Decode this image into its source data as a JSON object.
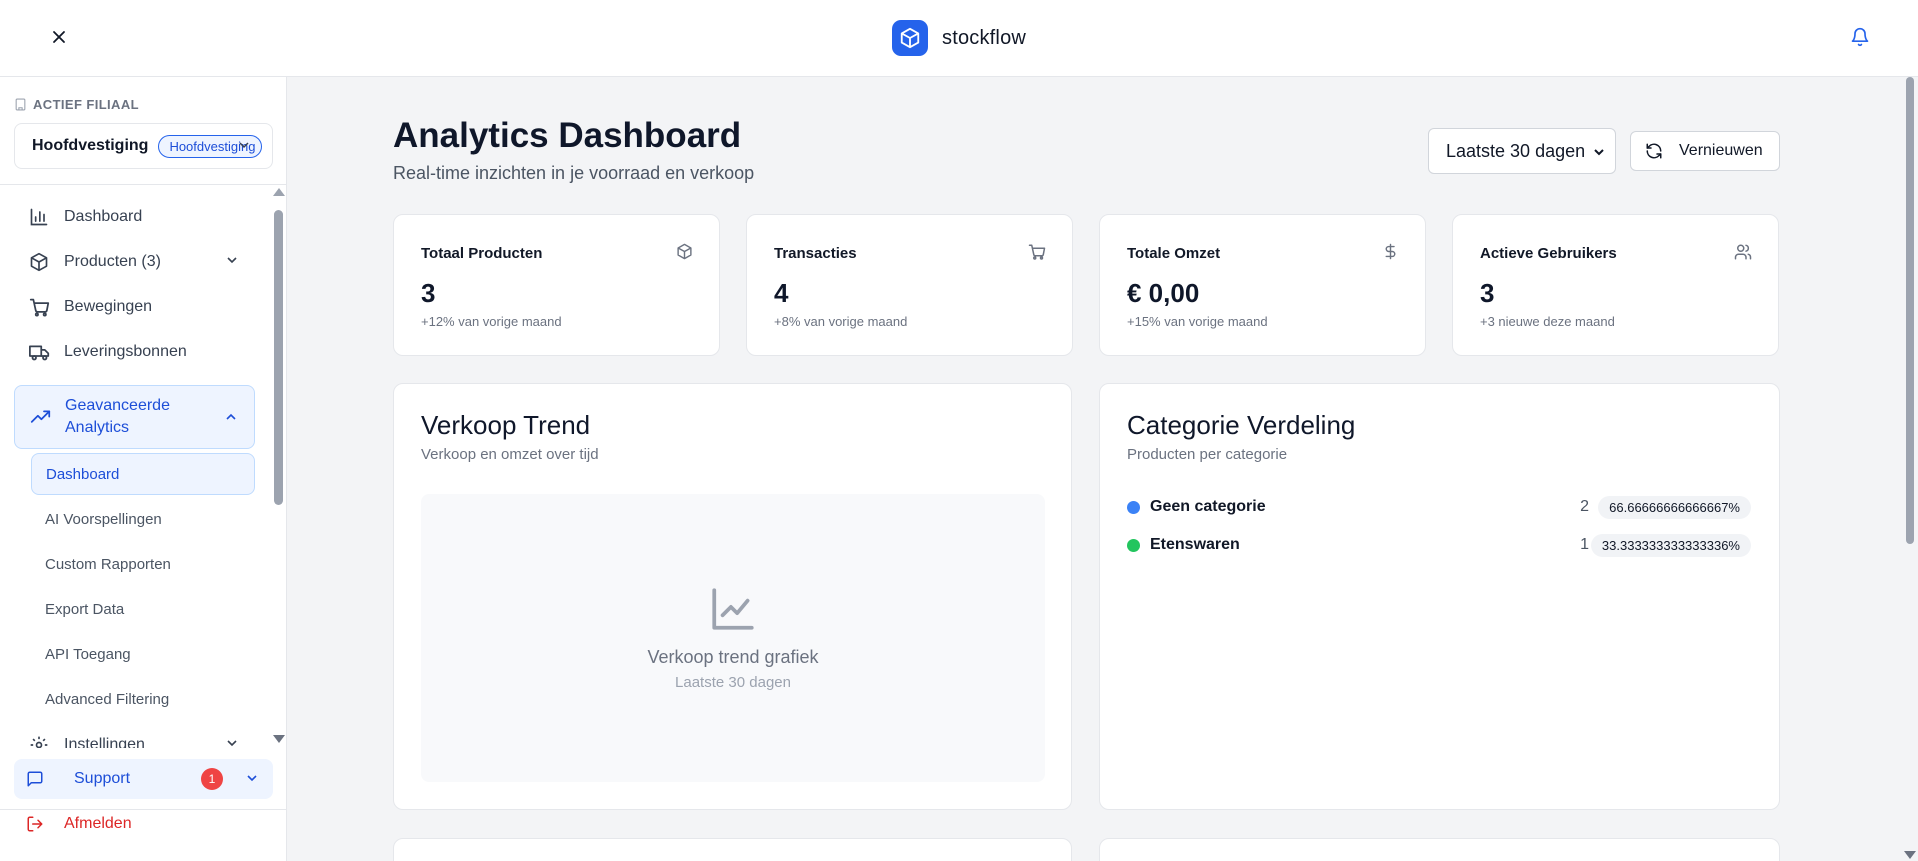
{
  "app": {
    "brand_name": "stockflow",
    "accent_color": "#2563eb"
  },
  "sidebar": {
    "branch_label": "ACTIEF FILIAAL",
    "branch_name": "Hoofdvestiging",
    "branch_badge": "Hoofdvestiging",
    "nav": [
      {
        "label": "Dashboard",
        "icon": "bar-chart-icon"
      },
      {
        "label": "Producten (3)",
        "icon": "package-icon"
      },
      {
        "label": "Bewegingen",
        "icon": "cart-icon"
      },
      {
        "label": "Leveringsbonnen",
        "icon": "truck-icon"
      },
      {
        "label": "Geavanceerde Analytics",
        "icon": "trending-up-icon"
      }
    ],
    "sub_nav": [
      {
        "label": "Dashboard"
      },
      {
        "label": "AI Voorspellingen"
      },
      {
        "label": "Custom Rapporten"
      },
      {
        "label": "Export Data"
      },
      {
        "label": "API Toegang"
      },
      {
        "label": "Advanced Filtering"
      }
    ],
    "settings_label": "Instellingen",
    "support_label": "Support",
    "support_badge": "1",
    "logout_label": "Afmelden"
  },
  "main": {
    "title": "Analytics Dashboard",
    "subtitle": "Real-time inzichten in je voorraad en verkoop",
    "range_value": "Laatste 30 dagen",
    "refresh_label": "Vernieuwen",
    "stats": [
      {
        "title": "Totaal Producten",
        "value": "3",
        "note": "+12% van vorige maand",
        "icon": "package-icon"
      },
      {
        "title": "Transacties",
        "value": "4",
        "note": "+8% van vorige maand",
        "icon": "cart-icon"
      },
      {
        "title": "Totale Omzet",
        "value": "€ 0,00",
        "note": "+15% van vorige maand",
        "icon": "dollar-icon"
      },
      {
        "title": "Actieve Gebruikers",
        "value": "3",
        "note": "+3 nieuwe deze maand",
        "icon": "users-icon"
      }
    ],
    "sales_trend": {
      "title": "Verkoop Trend",
      "subtitle": "Verkoop en omzet over tijd",
      "placeholder_title": "Verkoop trend grafiek",
      "placeholder_sub": "Laatste 30 dagen"
    },
    "category": {
      "title": "Categorie Verdeling",
      "subtitle": "Producten per categorie",
      "rows": [
        {
          "name": "Geen categorie",
          "count": "2",
          "percent": "66.66666666666667%",
          "color": "#3b82f6"
        },
        {
          "name": "Etenswaren",
          "count": "1",
          "percent": "33.333333333333336%",
          "color": "#22c55e"
        }
      ]
    }
  }
}
